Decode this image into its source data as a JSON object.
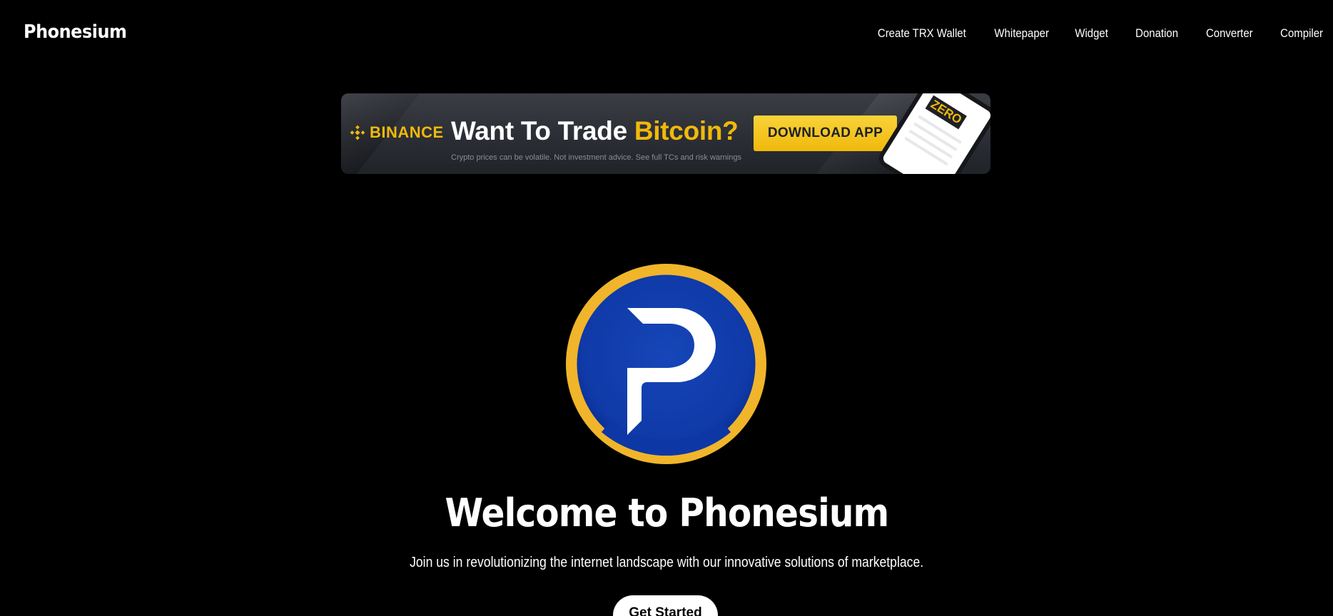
{
  "header": {
    "brand": "Phonesium",
    "nav": [
      {
        "label": "Create TRX Wallet"
      },
      {
        "label": "Whitepaper"
      },
      {
        "label": "Widget"
      },
      {
        "label": "Donation"
      },
      {
        "label": "Converter"
      },
      {
        "label": "Compiler"
      }
    ]
  },
  "ad": {
    "brand": "BINANCE",
    "headline_prefix": "Want To Trade ",
    "headline_highlight": "Bitcoin?",
    "cta": "DOWNLOAD APP",
    "disclaimer": "Crypto prices can be volatile. Not investment advice. See full TCs and risk warnings",
    "phone_badge": "ZERO",
    "colors": {
      "accent": "#f0b90b",
      "background": "#2b2e35"
    }
  },
  "hero": {
    "logo_icon": "phonesium-p-logo-icon",
    "logo_colors": {
      "ring": "#f0b52a",
      "disc": "#0f3aa8"
    },
    "title": "Welcome to Phonesium",
    "subtitle": "Join us in revolutionizing the internet landscape with our innovative solutions of marketplace.",
    "cta": "Get Started"
  }
}
